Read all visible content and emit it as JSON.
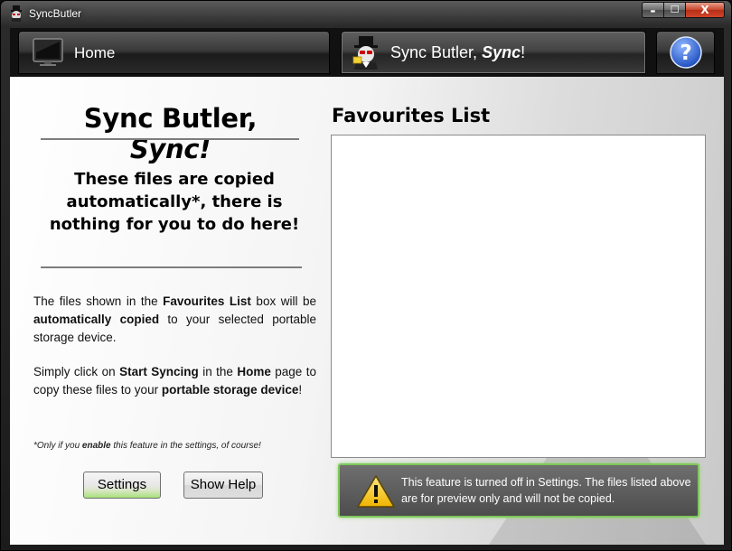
{
  "window": {
    "title": "SyncButler",
    "minimize_glyph": "▬",
    "maximize_glyph": "☐",
    "close_glyph": "X"
  },
  "tabs": {
    "home_label": "Home",
    "sync_label_prefix": "Sync Butler, ",
    "sync_label_emphasis": "Sync",
    "sync_label_suffix": "!",
    "help_icon": "question-mark-icon"
  },
  "left_panel": {
    "title_prefix": "Sync Butler, ",
    "title_emphasis": "Sync!",
    "notice": "These files are copied automatically*, there is nothing for you to do here!",
    "para1": {
      "t1": "The files shown in the ",
      "b1": "Favourites List",
      "t2": " box will be ",
      "b2": "automatically copied",
      "t3": " to your selected portable storage device."
    },
    "para2": {
      "t1": "Simply click on ",
      "b1": "Start Syncing",
      "t2": " in the ",
      "b2": "Home",
      "t3": " page to copy these files to your ",
      "b3": "portable storage device",
      "t4": "!"
    },
    "footnote": {
      "t1": "*Only if you ",
      "b1": "enable",
      "t2": " this feature in the settings, of course!"
    },
    "settings_button": "Settings",
    "show_help_button": "Show Help"
  },
  "right_panel": {
    "title": "Favourites List",
    "items": [],
    "warning": "This feature is turned off in Settings. The files listed above are for preview only and will not be copied."
  },
  "colors": {
    "warning_border": "#7dc75a",
    "settings_glow": "#a8e27a"
  }
}
